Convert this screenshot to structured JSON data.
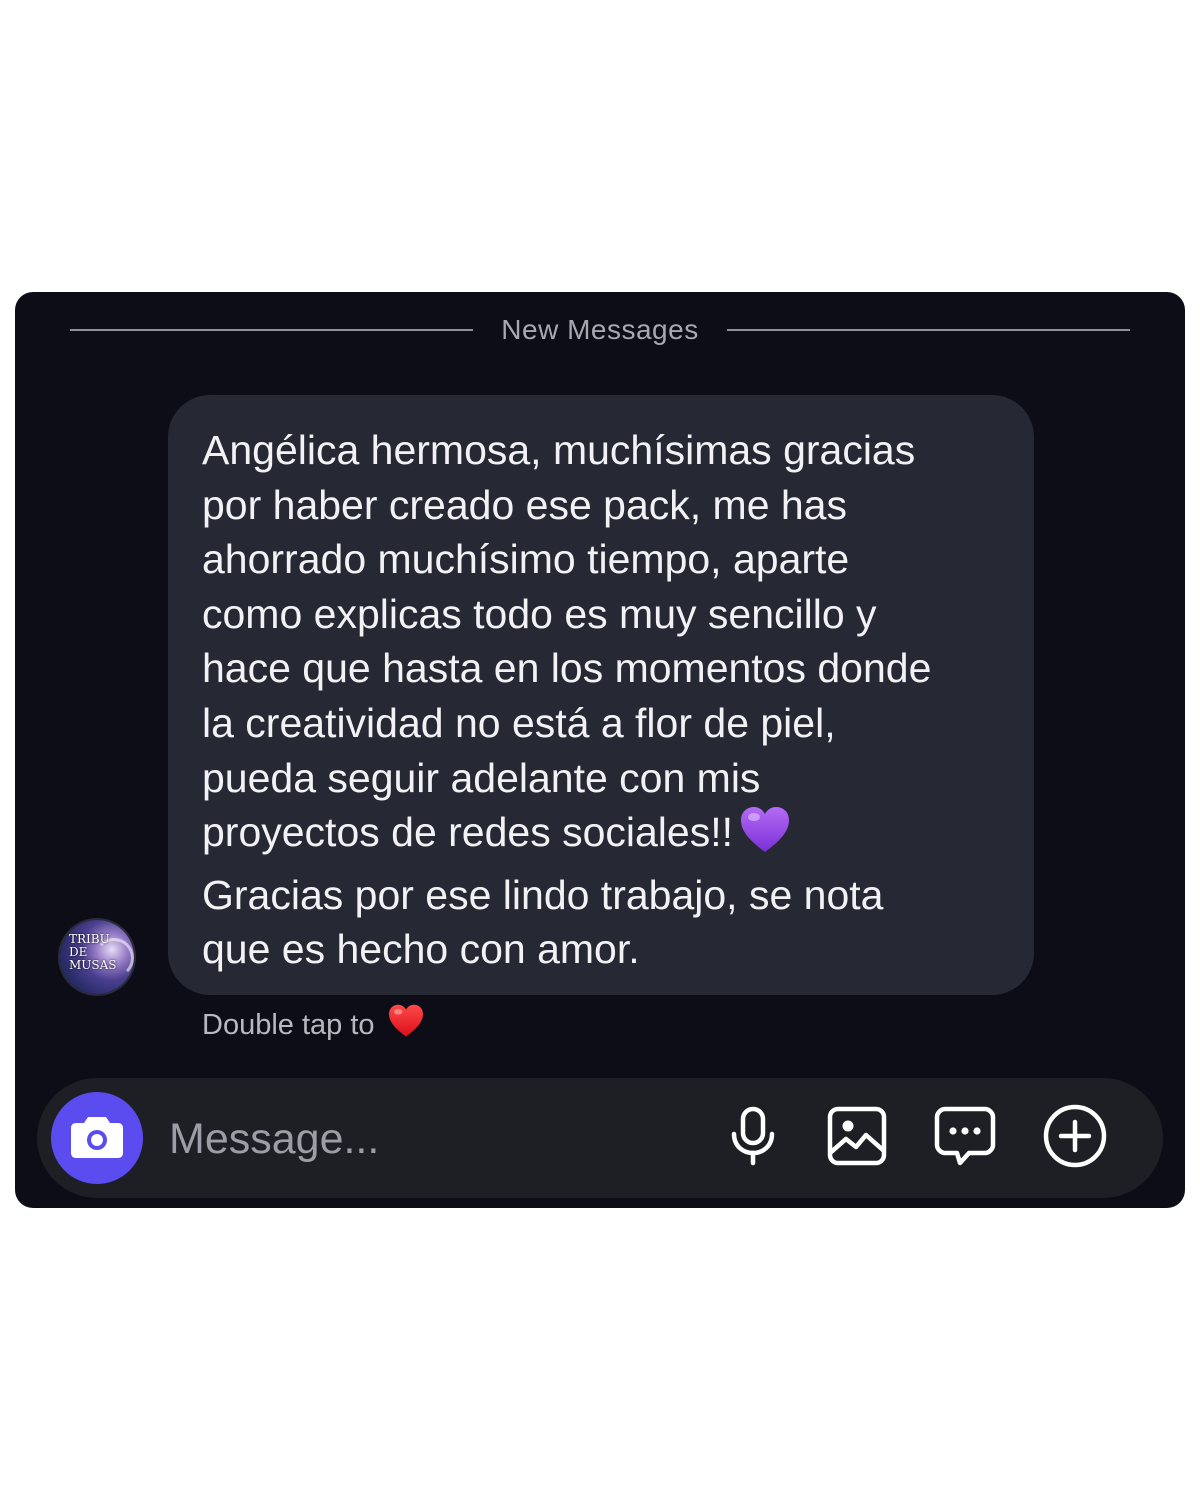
{
  "divider": {
    "label": "New Messages"
  },
  "avatar": {
    "text": "TRIBU\nDE\nMUSAS"
  },
  "message": {
    "text": "Angélica hermosa, muchísimas gracias\npor haber creado ese pack,  me has\nahorrado muchísimo tiempo, aparte\ncomo explicas todo es muy sencillo y\nhace que hasta en los momentos donde\nla creatividad no está a flor de piel,\npueda seguir adelante con mis\nproyectos de redes sociales!!",
    "text_after_emoji": "\nGracias por ese lindo trabajo, se nota\nque es hecho con amor.",
    "emoji": "purple-heart-icon"
  },
  "hint": {
    "label": "Double tap to",
    "icon": "red-heart-icon"
  },
  "composer": {
    "placeholder": "Message...",
    "camera_icon": "camera-icon",
    "tools": [
      "microphone-icon",
      "gallery-icon",
      "chat-bubble-icon",
      "plus-circle-icon"
    ]
  },
  "colors": {
    "background": "#0c0d16",
    "bubble": "#262833",
    "accent": "#5b4cf0",
    "composer": "#1e1f24"
  }
}
